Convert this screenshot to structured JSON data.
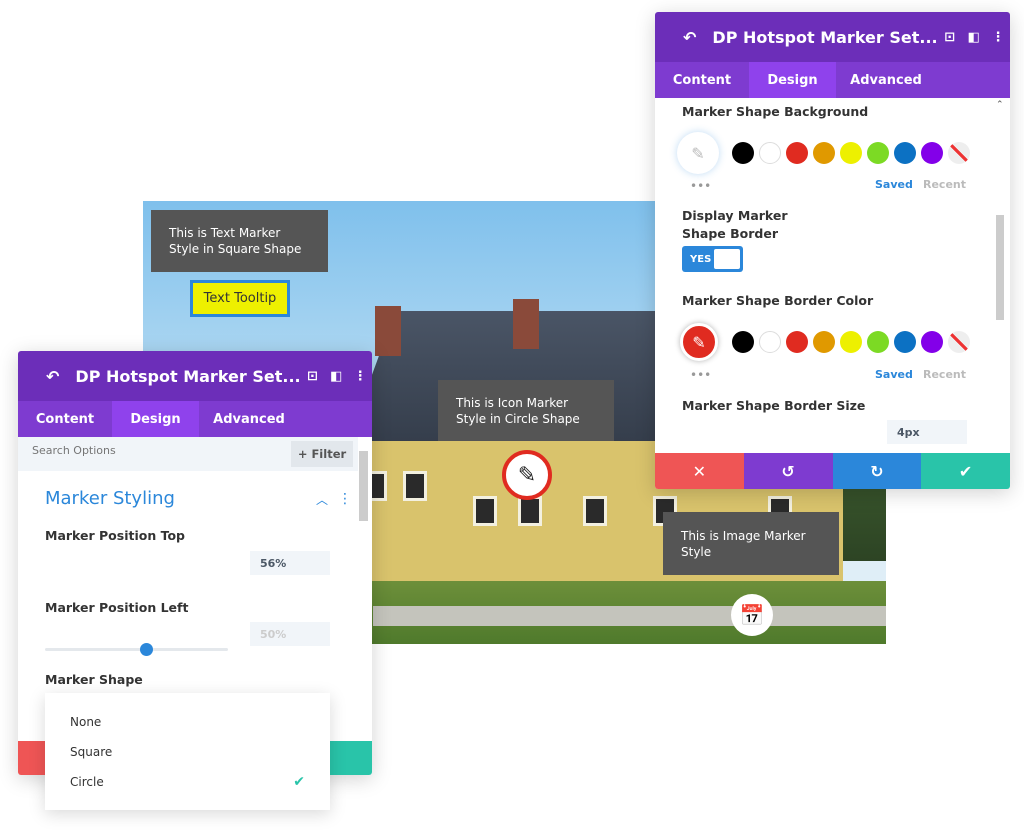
{
  "photo": {
    "tooltips": {
      "text_marker": "This is Text Marker Style in Square Shape",
      "text_tooltip": "Text Tooltip",
      "icon_marker": "This is Icon Marker Style in Circle Shape",
      "image_marker": "This is Image Marker Style"
    }
  },
  "right_panel": {
    "title": "DP Hotspot Marker Set...",
    "tabs": [
      "Content",
      "Design",
      "Advanced"
    ],
    "active_tab": "Design",
    "marker_shape_background": {
      "label": "Marker Shape Background",
      "saved": "Saved",
      "recent": "Recent"
    },
    "display_border": {
      "label": "Display Marker Shape Border",
      "toggle": "YES"
    },
    "border_color": {
      "label": "Marker Shape Border Color",
      "selected": "#e02b20",
      "saved": "Saved",
      "recent": "Recent"
    },
    "border_size": {
      "label": "Marker Shape Border Size",
      "value": "4px",
      "fraction": 0.04
    }
  },
  "swatches": [
    "#000000",
    "#ffffff",
    "#e02b20",
    "#e09900",
    "#edf000",
    "#7cda24",
    "#0c71c3",
    "#8300e9"
  ],
  "left_panel": {
    "title": "DP Hotspot Marker Set...",
    "tabs": [
      "Content",
      "Design",
      "Advanced"
    ],
    "active_tab": "Design",
    "search_placeholder": "Search Options",
    "filter": "+ Filter",
    "section": "Marker Styling",
    "position_top": {
      "label": "Marker Position Top",
      "value": "56%"
    },
    "position_left": {
      "label": "Marker Position Left",
      "value": "50%"
    },
    "marker_shape": {
      "label": "Marker Shape",
      "options": [
        "None",
        "Square",
        "Circle"
      ],
      "selected": "Circle"
    }
  },
  "colors": {
    "header": "#6c2eb9",
    "tabs": "#7e3bd0",
    "cancel": "#ef5555",
    "undo": "#7e3bd0",
    "redo": "#2b87da",
    "save": "#29c4a9",
    "accent": "#2b87da"
  }
}
